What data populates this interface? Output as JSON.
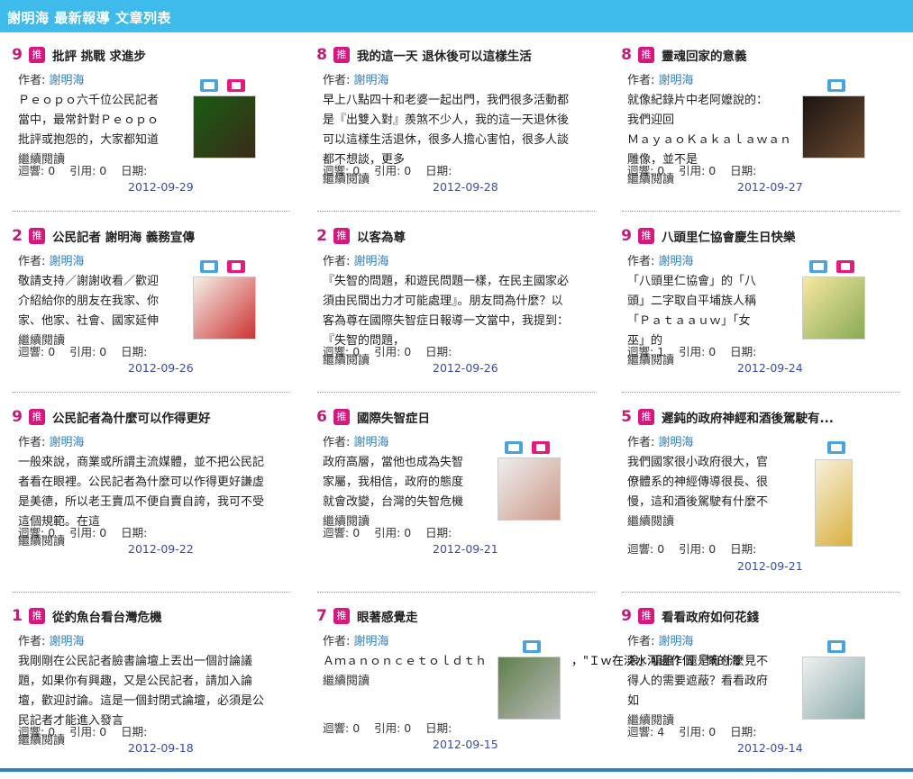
{
  "header": {
    "title": "謝明海 最新報導 文章列表"
  },
  "labels": {
    "author_prefix": "作者:",
    "echo": "迴響:",
    "cite": "引用:",
    "date": "日期:",
    "more": "繼續閱讀",
    "push": "推"
  },
  "colors": {
    "topbar": "#3ebbea",
    "accent": "#c01d7a",
    "link": "#2d7fbf"
  },
  "articles": [
    {
      "count": "9",
      "title": "批評 挑戰 求進步",
      "author": "謝明海",
      "body": [
        "Ｐｅｏｐｏ六千位公民記者",
        "當中，最常針對Ｐｅｏｐｏ",
        "批評或抱怨的，大家都知道"
      ],
      "echo": "0",
      "cite": "0",
      "date": "2012-09-29"
    },
    {
      "count": "8",
      "title": "我的這一天 退休後可以這樣生活",
      "author": "謝明海",
      "body": [
        "早上八點四十和老婆一起出門，我們很多活動都",
        "是『出雙入對』羨煞不少人，我的這一天退休後",
        "可以這樣生活退休，很多人擔心害怕，很多人談",
        "都不想談，更多"
      ],
      "echo": "0",
      "cite": "0",
      "date": "2012-09-28"
    },
    {
      "count": "8",
      "title": "靈魂回家的意義",
      "author": "謝明海",
      "body": [
        "就像紀錄片中老阿嬤說的：",
        "我們迎回",
        "ＭａｙａｏＫａｋａｌａｗａｎ",
        "雕像，並不是"
      ],
      "echo": "0",
      "cite": "0",
      "date": "2012-09-27"
    },
    {
      "count": "2",
      "title": "公民記者 謝明海 義務宣傳",
      "author": "謝明海",
      "body": [
        "敬請支持／謝謝收看／歡迎",
        "介紹給你的朋友在我家、你",
        "家、他家、社會、國家延伸"
      ],
      "echo": "0",
      "cite": "0",
      "date": "2012-09-26"
    },
    {
      "count": "2",
      "title": "以客為尊",
      "author": "謝明海",
      "body": [
        "『失智的問題，和遊民問題一樣，在民主國家必",
        "須由民間出力才可能處理』。朋友問為什麼？以",
        "客為尊在國際失智症日報導一文當中，我提到：",
        "『失智的問題，"
      ],
      "echo": "0",
      "cite": "0",
      "date": "2012-09-26"
    },
    {
      "count": "9",
      "title": "八頭里仁協會慶生日快樂",
      "author": "謝明海",
      "body": [
        "「八頭里仁協會」的「八",
        "頭」二字取自平埔族人稱",
        "「Ｐａｔａａｕｗ」「女",
        "巫」的"
      ],
      "echo": "1",
      "cite": "0",
      "date": "2012-09-24"
    },
    {
      "count": "9",
      "title": "公民記者為什麼可以作得更好",
      "author": "謝明海",
      "body": [
        "一般來說，商業或所謂主流媒體，並不把公民記",
        "者看在眼裡。公民記者為什麼可以作得更好謙虛",
        "是美德，所以老王賣瓜不便自賣自誇，我可不受",
        "這個規範。在這"
      ],
      "echo": "0",
      "cite": "0",
      "date": "2012-09-22"
    },
    {
      "count": "6",
      "title": "國際失智症日",
      "author": "謝明海",
      "body": [
        "政府高層，當他也成為失智",
        "家屬，我相信，政府的態度",
        "就會改變，台灣的失智危機"
      ],
      "echo": "0",
      "cite": "0",
      "date": "2012-09-21"
    },
    {
      "count": "5",
      "title": "遲鈍的政府神經和酒後駕駛有...",
      "author": "謝明海",
      "body": [
        "我們國家很小政府很大，官",
        "僚體系的神經傳導很長、很",
        "慢，這和酒後駕駛有什麼不"
      ],
      "echo": "0",
      "cite": "0",
      "date": "2012-09-21"
    },
    {
      "count": "1",
      "title": "從釣魚台看台灣危機",
      "author": "謝明海",
      "body": [
        "我剛剛在公民記者臉書論壇上丟出一個討論議",
        "題，如果你有興趣，又是公民記者，請加入論",
        "壇，歡迎討論。這是一個封閉式論壇，必須是公",
        "民記者才能進入發言"
      ],
      "echo": "0",
      "cite": "0",
      "date": "2012-09-18"
    },
    {
      "count": "7",
      "title": "眼著感覺走",
      "author": "謝明海",
      "body": [
        "Ａｍａｎｏｎｃｅｔｏｌｄｔｈ"
      ],
      "overflow": "，\"Ｉｗ在淡水河邊作個『慨的海",
      "echo": "0",
      "cite": "0",
      "date": "2012-09-15"
    },
    {
      "count": "9",
      "title": "看看政府如何花錢",
      "author": "謝明海",
      "body": [
        "浪』騙誰？還是有什麼見不",
        "得人的需要遮蔽？看看政府",
        "如"
      ],
      "echo": "4",
      "cite": "0",
      "date": "2012-09-14"
    }
  ]
}
